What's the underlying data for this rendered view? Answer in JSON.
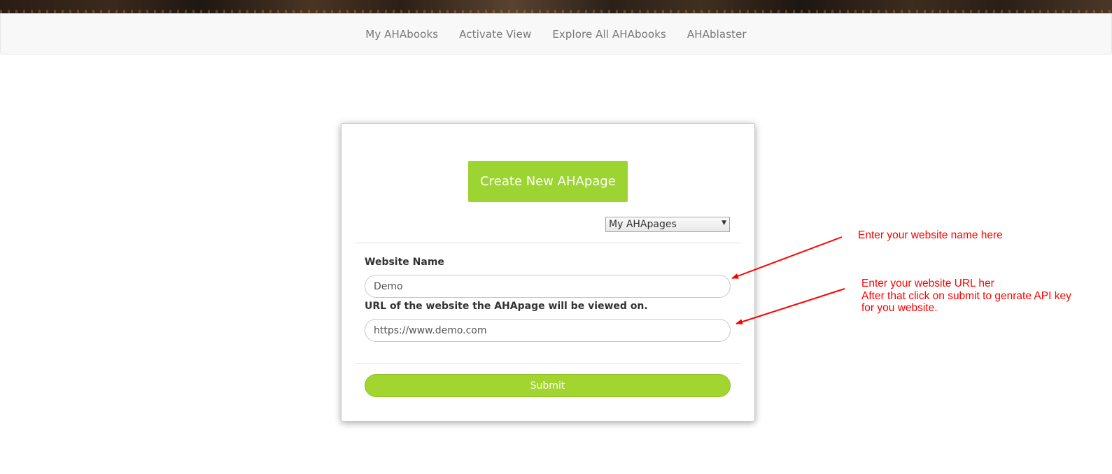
{
  "nav": {
    "items": [
      {
        "label": "My AHAbooks"
      },
      {
        "label": "Activate View"
      },
      {
        "label": "Explore All AHAbooks"
      },
      {
        "label": "AHAblaster"
      }
    ]
  },
  "card": {
    "create_button_label": "Create New AHApage",
    "pages_select": {
      "selected": "My AHApages"
    },
    "website_name": {
      "label": "Website Name",
      "value": "Demo"
    },
    "website_url": {
      "label": "URL of the website the AHApage will be viewed on.",
      "value": "https://www.demo.com"
    },
    "submit_label": "Submit"
  },
  "annotations": {
    "name_note": "Enter your website name here",
    "url_note_line1": "Enter your website URL her",
    "url_note_line2": "After that click on submit to genrate API key",
    "url_note_line3": "for you website."
  },
  "colors": {
    "brand_green": "#9cd431",
    "annotation_red": "#ff0000",
    "nav_text": "#777777"
  }
}
